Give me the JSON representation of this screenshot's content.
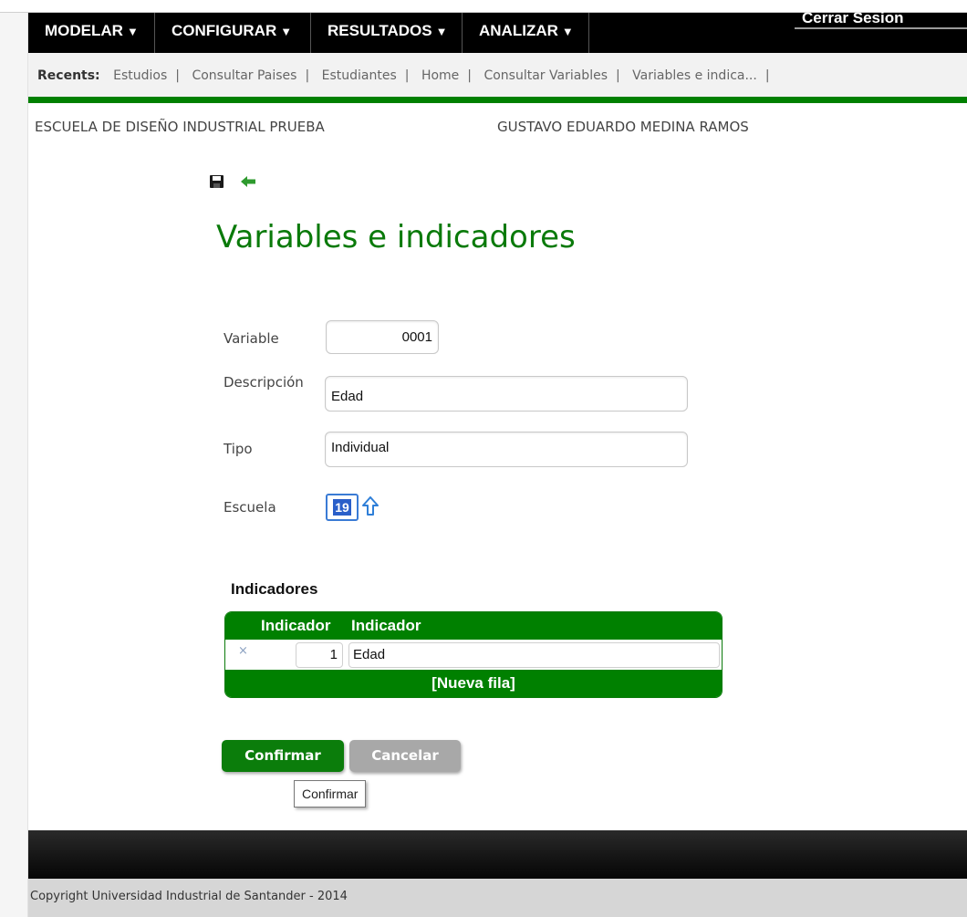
{
  "nav": {
    "items": [
      {
        "label": "MODELAR"
      },
      {
        "label": "CONFIGURAR"
      },
      {
        "label": "RESULTADOS"
      },
      {
        "label": "ANALIZAR"
      }
    ],
    "logout": "Cerrar Sesion"
  },
  "recents": {
    "label": "Recents:",
    "links": [
      "Estudios",
      "Consultar Paises",
      "Estudiantes",
      "Home",
      "Consultar Variables",
      "Variables e indica..."
    ],
    "separator": "|"
  },
  "context": {
    "school": "ESCUELA DE DISEÑO INDUSTRIAL PRUEBA",
    "user": "GUSTAVO EDUARDO MEDINA RAMOS"
  },
  "icons": {
    "save": "save-icon",
    "back": "back-arrow-icon",
    "lookup": "up-arrow-icon"
  },
  "page": {
    "title": "Variables e indicadores"
  },
  "form": {
    "variable": {
      "label": "Variable",
      "value": "0001"
    },
    "descripcion": {
      "label": "Descripción",
      "value": "Edad"
    },
    "tipo": {
      "label": "Tipo",
      "value": "Individual"
    },
    "escuela": {
      "label": "Escuela",
      "value": "19"
    }
  },
  "indicadores": {
    "title": "Indicadores",
    "columns": [
      "Indicador",
      "Indicador"
    ],
    "rows": [
      {
        "delete": "×",
        "number": "1",
        "name": "Edad"
      }
    ],
    "new_row": "[Nueva fila]"
  },
  "actions": {
    "confirm": "Confirmar",
    "cancel": "Cancelar",
    "tooltip": "Confirmar"
  },
  "footer": {
    "copyright": "Copyright Universidad Industrial de Santander - 2014"
  },
  "colors": {
    "accent_green": "#008000",
    "title_green": "#0a7a0a",
    "nav_black": "#000000",
    "cancel_gray": "#a8a8a8"
  }
}
